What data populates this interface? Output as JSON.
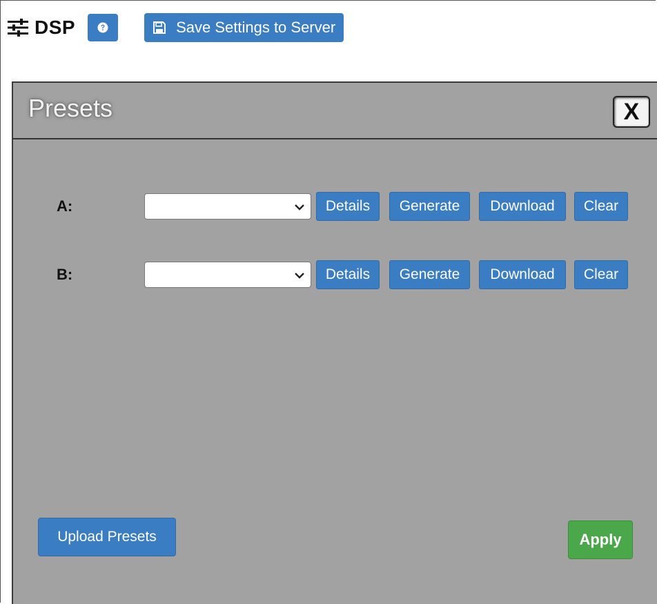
{
  "header": {
    "icon": "sliders-icon",
    "title": "DSP",
    "help_icon": "question-circle-icon",
    "save_button_icon": "floppy-disk-icon",
    "save_button_label": "Save Settings to Server"
  },
  "dialog": {
    "title": "Presets",
    "close_label": "X",
    "rows": [
      {
        "label": "A:",
        "selected_value": "",
        "buttons": [
          "Details",
          "Generate",
          "Download",
          "Clear"
        ]
      },
      {
        "label": "B:",
        "selected_value": "",
        "buttons": [
          "Details",
          "Generate",
          "Download",
          "Clear"
        ]
      }
    ],
    "upload_label": "Upload Presets",
    "apply_label": "Apply"
  },
  "colors": {
    "primary_button": "#3a7dc3",
    "apply_button": "#4aa84a",
    "dialog_background": "#a2a2a2"
  }
}
